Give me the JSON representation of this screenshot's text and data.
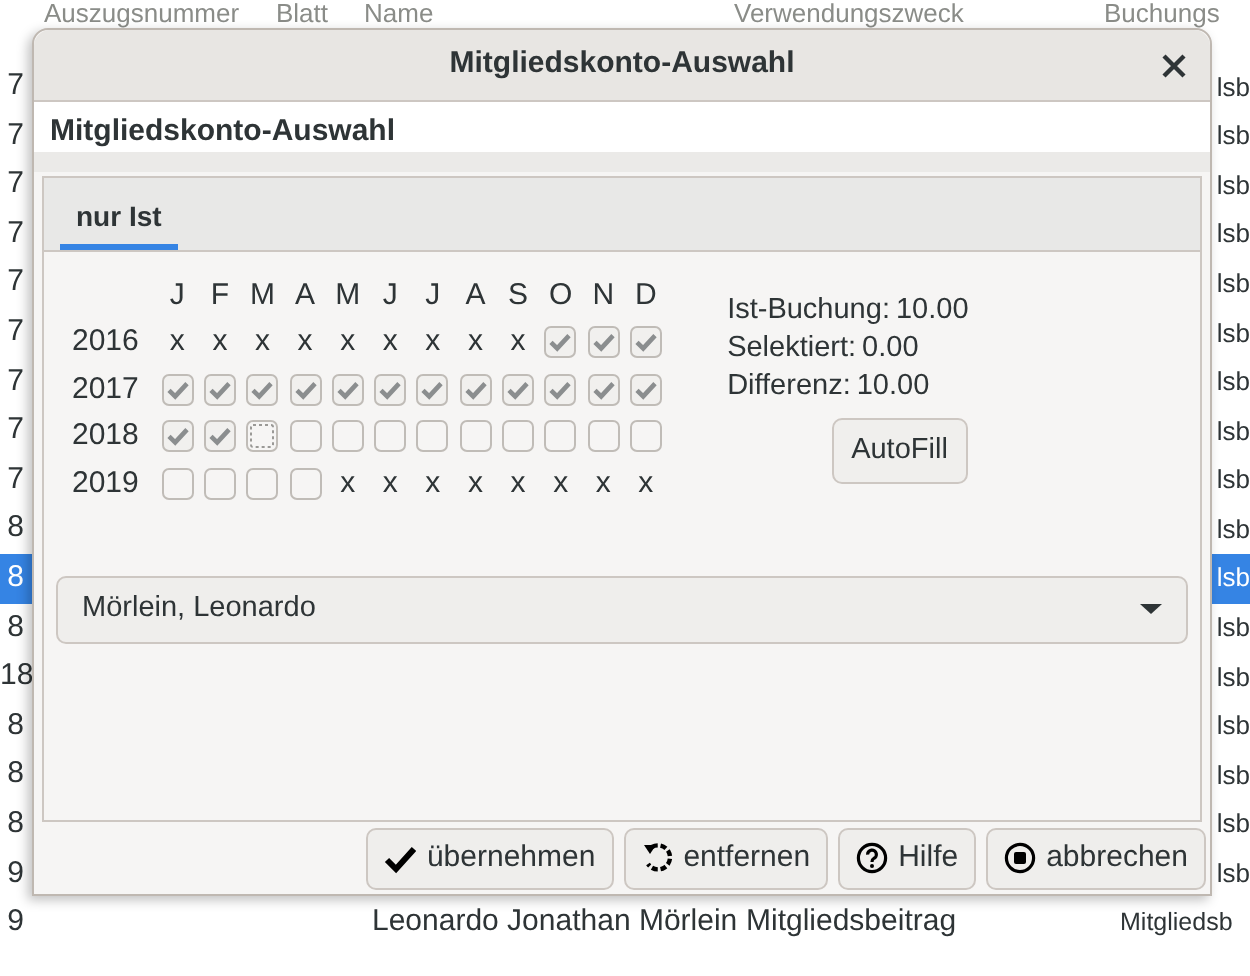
{
  "background_table": {
    "columns": [
      "Auszugsnummer",
      "Blatt",
      "Name",
      "Verwendungszweck",
      "Buchungs"
    ],
    "rows": [
      {
        "first": "7",
        "booking": "lsb",
        "selected": false
      },
      {
        "first": "7",
        "booking": "lsb",
        "selected": false
      },
      {
        "first": "7",
        "booking": "lsb",
        "selected": false
      },
      {
        "first": "7",
        "booking": "lsb",
        "selected": false
      },
      {
        "first": "7",
        "booking": "lsb",
        "selected": false
      },
      {
        "first": "7",
        "booking": "lsb",
        "selected": false
      },
      {
        "first": "7",
        "booking": "lsb",
        "selected": false
      },
      {
        "first": "7",
        "booking": "lsb",
        "selected": false
      },
      {
        "first": "7",
        "booking": "lsb",
        "selected": false
      },
      {
        "first": "8",
        "booking": "lsb",
        "selected": false
      },
      {
        "first": "8",
        "booking": "lsb",
        "selected": true
      },
      {
        "first": "8",
        "booking": "lsb",
        "selected": false
      },
      {
        "first": "18",
        "booking": "lsb",
        "selected": false
      },
      {
        "first": "8",
        "booking": "lsb",
        "selected": false
      },
      {
        "first": "8",
        "booking": "lsb",
        "selected": false
      },
      {
        "first": "8",
        "booking": "lsb",
        "selected": false
      },
      {
        "first": "9",
        "booking": "lsb",
        "selected": false
      },
      {
        "first": "9",
        "name": "Leonardo Jonathan Mörlein",
        "purpose": "Mitgliedsbeitrag",
        "booking": "Mitgliedsb",
        "selected": false
      }
    ]
  },
  "dialog": {
    "title": "Mitgliedskonto-Auswahl",
    "heading": "Mitgliedskonto-Auswahl",
    "tabs": [
      {
        "label": "nur Ist",
        "selected": true
      }
    ],
    "months": [
      "J",
      "F",
      "M",
      "A",
      "M",
      "J",
      "J",
      "A",
      "S",
      "O",
      "N",
      "D"
    ],
    "years": [
      {
        "label": "2016",
        "cells": [
          {
            "kind": "mark",
            "text": "x"
          },
          {
            "kind": "mark",
            "text": "x"
          },
          {
            "kind": "mark",
            "text": "x"
          },
          {
            "kind": "mark",
            "text": "x"
          },
          {
            "kind": "mark",
            "text": "x"
          },
          {
            "kind": "mark",
            "text": "x"
          },
          {
            "kind": "mark",
            "text": "x"
          },
          {
            "kind": "mark",
            "text": "x"
          },
          {
            "kind": "mark",
            "text": "x"
          },
          {
            "kind": "checkbox",
            "checked": true,
            "focused": false
          },
          {
            "kind": "checkbox",
            "checked": true,
            "focused": false
          },
          {
            "kind": "checkbox",
            "checked": true,
            "focused": false
          }
        ]
      },
      {
        "label": "2017",
        "cells": [
          {
            "kind": "checkbox",
            "checked": true,
            "focused": false
          },
          {
            "kind": "checkbox",
            "checked": true,
            "focused": false
          },
          {
            "kind": "checkbox",
            "checked": true,
            "focused": false
          },
          {
            "kind": "checkbox",
            "checked": true,
            "focused": false
          },
          {
            "kind": "checkbox",
            "checked": true,
            "focused": false
          },
          {
            "kind": "checkbox",
            "checked": true,
            "focused": false
          },
          {
            "kind": "checkbox",
            "checked": true,
            "focused": false
          },
          {
            "kind": "checkbox",
            "checked": true,
            "focused": false
          },
          {
            "kind": "checkbox",
            "checked": true,
            "focused": false
          },
          {
            "kind": "checkbox",
            "checked": true,
            "focused": false
          },
          {
            "kind": "checkbox",
            "checked": true,
            "focused": false
          },
          {
            "kind": "checkbox",
            "checked": true,
            "focused": false
          }
        ]
      },
      {
        "label": "2018",
        "cells": [
          {
            "kind": "checkbox",
            "checked": true,
            "focused": false
          },
          {
            "kind": "checkbox",
            "checked": true,
            "focused": false
          },
          {
            "kind": "checkbox",
            "checked": false,
            "focused": true
          },
          {
            "kind": "checkbox",
            "checked": false,
            "focused": false
          },
          {
            "kind": "checkbox",
            "checked": false,
            "focused": false
          },
          {
            "kind": "checkbox",
            "checked": false,
            "focused": false
          },
          {
            "kind": "checkbox",
            "checked": false,
            "focused": false
          },
          {
            "kind": "checkbox",
            "checked": false,
            "focused": false
          },
          {
            "kind": "checkbox",
            "checked": false,
            "focused": false
          },
          {
            "kind": "checkbox",
            "checked": false,
            "focused": false
          },
          {
            "kind": "checkbox",
            "checked": false,
            "focused": false
          },
          {
            "kind": "checkbox",
            "checked": false,
            "focused": false
          }
        ]
      },
      {
        "label": "2019",
        "cells": [
          {
            "kind": "checkbox",
            "checked": false,
            "focused": false
          },
          {
            "kind": "checkbox",
            "checked": false,
            "focused": false
          },
          {
            "kind": "checkbox",
            "checked": false,
            "focused": false
          },
          {
            "kind": "checkbox",
            "checked": false,
            "focused": false
          },
          {
            "kind": "mark",
            "text": "x"
          },
          {
            "kind": "mark",
            "text": "x"
          },
          {
            "kind": "mark",
            "text": "x"
          },
          {
            "kind": "mark",
            "text": "x"
          },
          {
            "kind": "mark",
            "text": "x"
          },
          {
            "kind": "mark",
            "text": "x"
          },
          {
            "kind": "mark",
            "text": "x"
          },
          {
            "kind": "mark",
            "text": "x"
          }
        ]
      }
    ],
    "summary": [
      {
        "label": "Ist-Buchung:",
        "value": "10.00"
      },
      {
        "label": "Selektiert:",
        "value": "0.00"
      },
      {
        "label": "Differenz:",
        "value": "10.00"
      }
    ],
    "autofill": "AutoFill",
    "member": "Mörlein, Leonardo",
    "buttons": [
      {
        "kind": "check",
        "label": "übernehmen"
      },
      {
        "kind": "undo",
        "label": "entfernen"
      },
      {
        "kind": "help",
        "label": "Hilfe"
      },
      {
        "kind": "stop",
        "label": "abbrechen"
      }
    ]
  }
}
